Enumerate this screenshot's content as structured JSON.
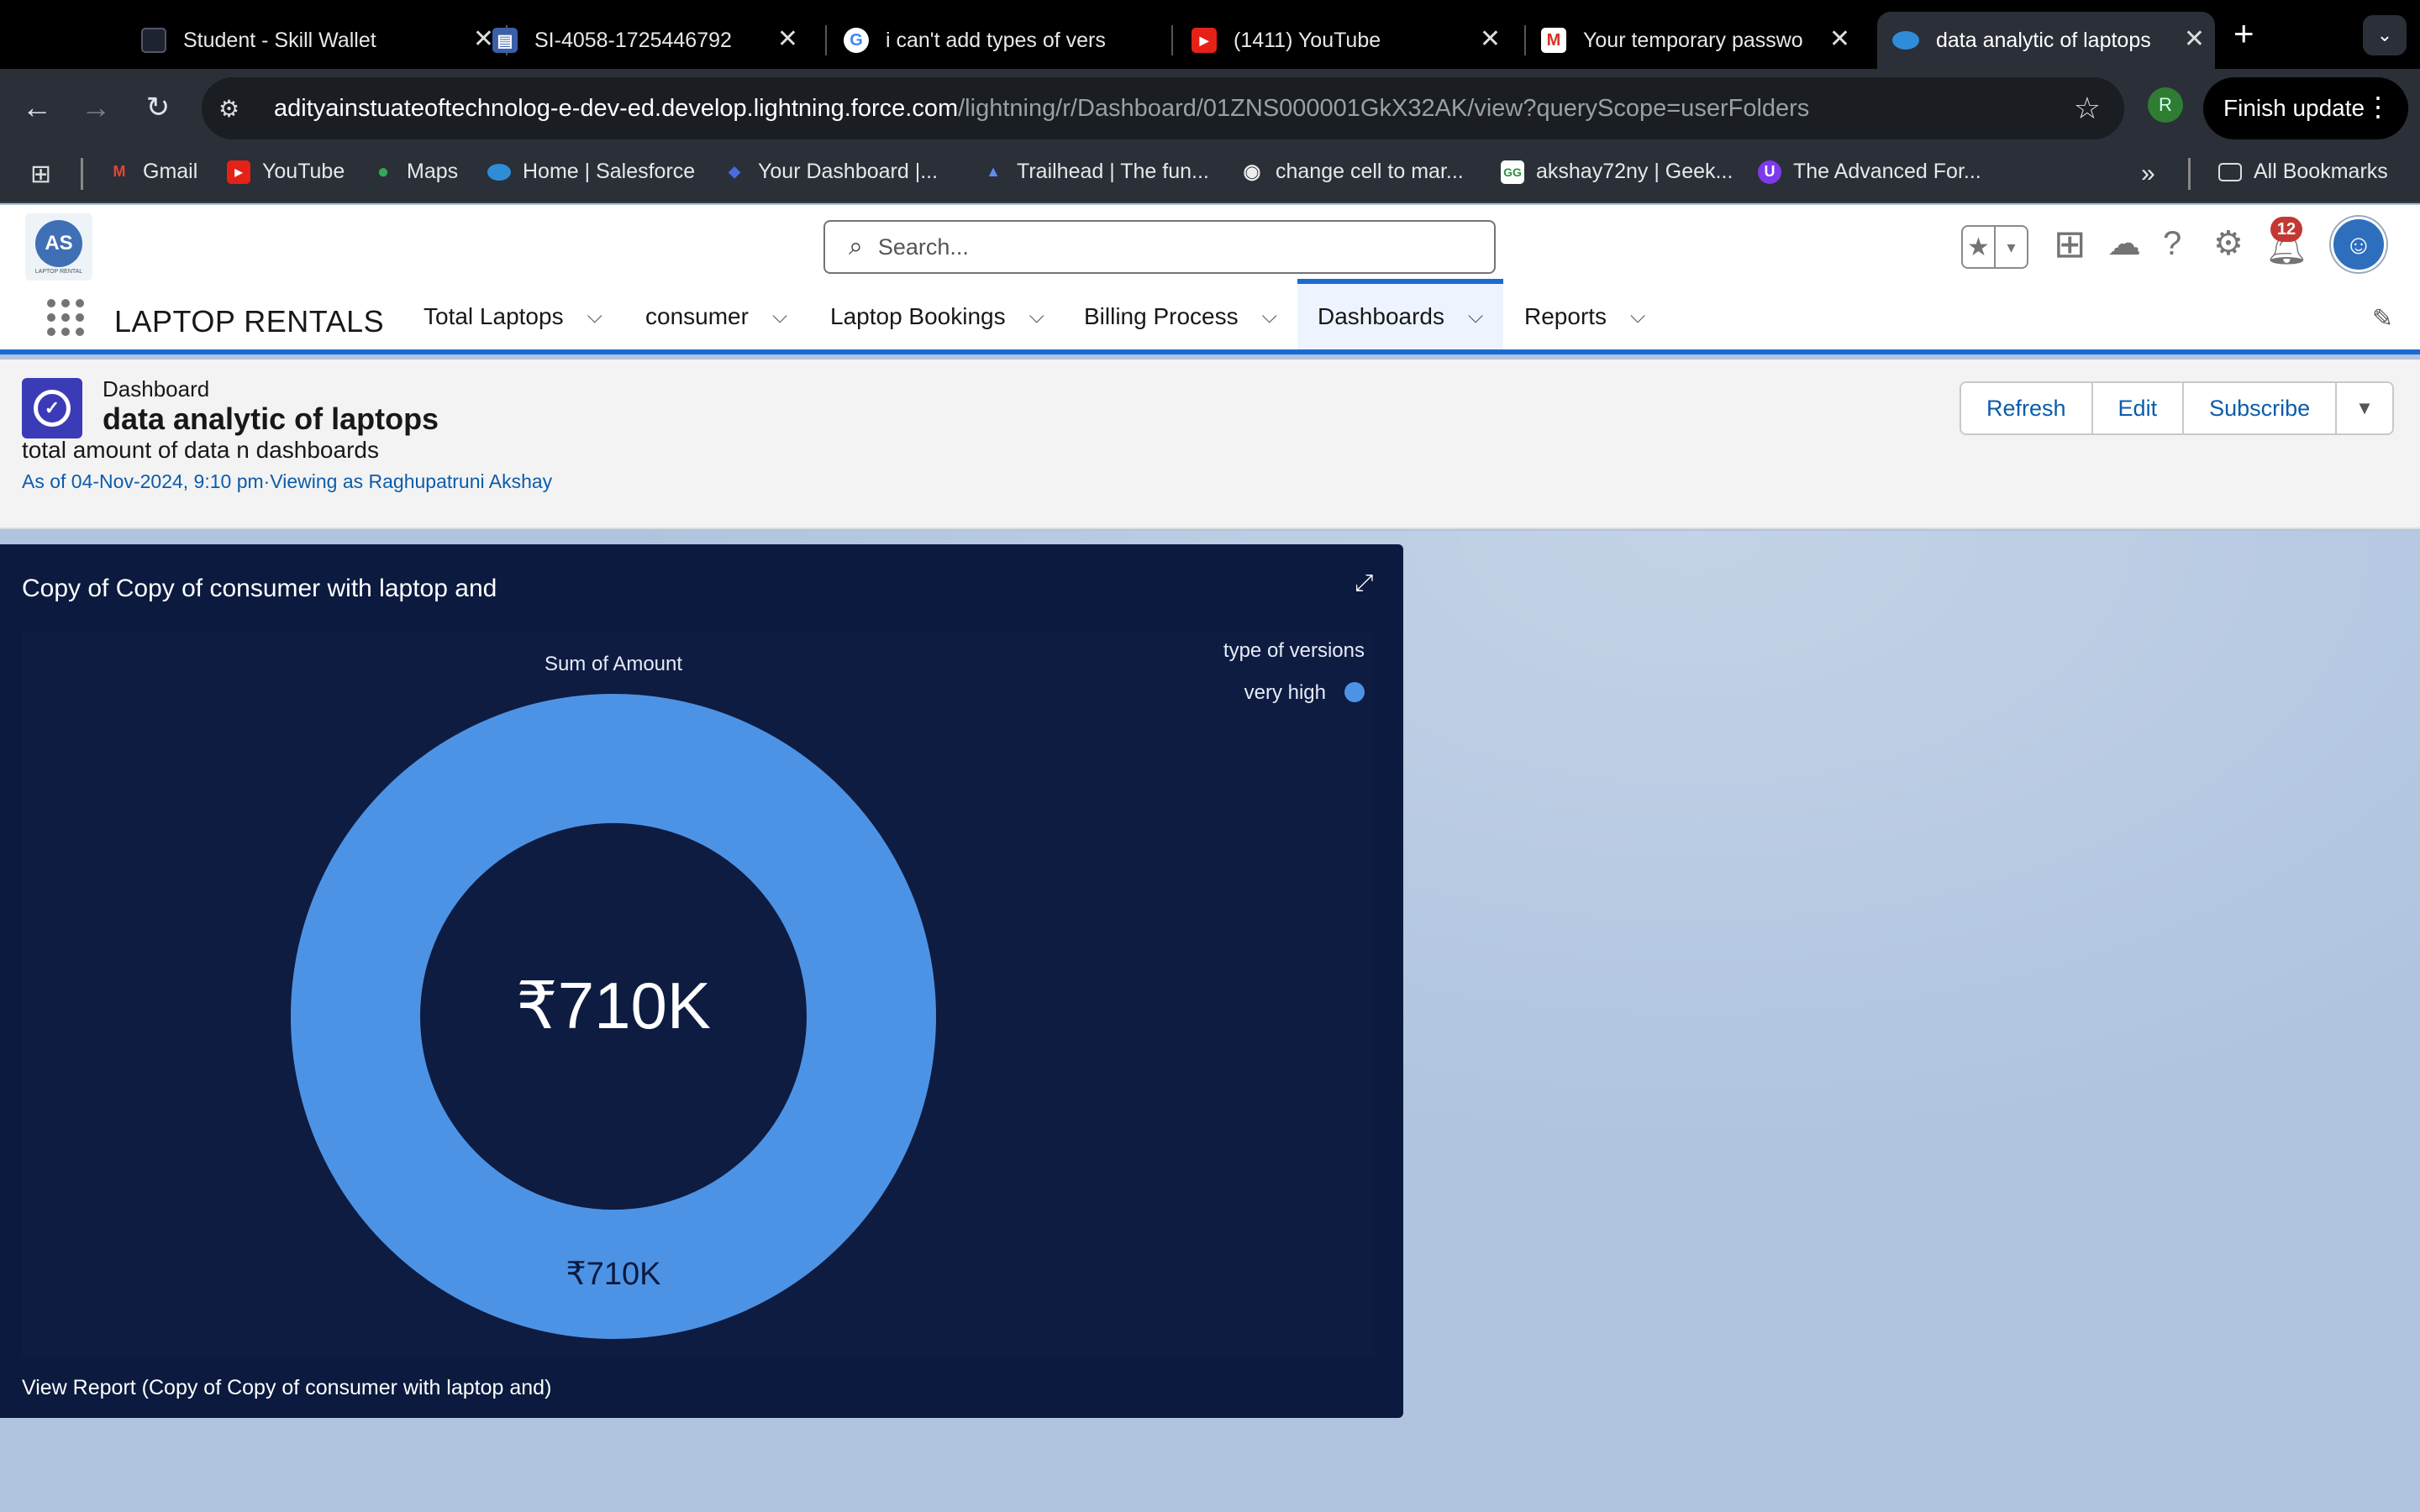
{
  "browser": {
    "tabs": [
      {
        "title": "Student - Skill Wallet",
        "favicon_color": "#2c3440"
      },
      {
        "title": "SI-4058-1725446792",
        "favicon_color": "#3b5fa8"
      },
      {
        "title": "i can't add types of vers",
        "favicon_color": "#ffffff"
      },
      {
        "title": "(1411) YouTube",
        "favicon_color": "#e62117"
      },
      {
        "title": "Your temporary passwo",
        "favicon_color": "#ffffff"
      },
      {
        "title": "data analytic of laptops",
        "favicon_color": "#2f8dd8"
      }
    ],
    "url_host": "adityainstuateoftechnolog-e-dev-ed.develop.lightning.force.com",
    "url_path": "/lightning/r/Dashboard/01ZNS000001GkX32AK/view?queryScope=userFolders",
    "profile_initial": "R",
    "finish_update_label": "Finish update",
    "bookmarks": [
      "Gmail",
      "YouTube",
      "Maps",
      "Home | Salesforce",
      "Your Dashboard |...",
      "Trailhead | The fun...",
      "change cell to mar...",
      "akshay72ny | Geek...",
      "The Advanced For..."
    ],
    "all_bookmarks_label": "All Bookmarks"
  },
  "sf": {
    "logo_text": "AS",
    "logo_subtext": "LAPTOP RENTAL",
    "search_placeholder": "Search...",
    "notification_count": "12",
    "app_name": "LAPTOP RENTALS",
    "nav_tabs": [
      "Total Laptops",
      "consumer",
      "Laptop Bookings",
      "Billing Process",
      "Dashboards",
      "Reports"
    ],
    "active_tab": "Dashboards"
  },
  "dashboard": {
    "kicker": "Dashboard",
    "title": "data analytic of laptops",
    "description": "total amount of data n dashboards",
    "as_of": "As of 04-Nov-2024, 9:10 pm·Viewing as Raghupatruni Akshay",
    "buttons": {
      "refresh": "Refresh",
      "edit": "Edit",
      "subscribe": "Subscribe"
    }
  },
  "widget": {
    "title": "Copy of Copy of consumer with laptop and",
    "view_report": "View Report (Copy of Copy of consumer with laptop and)"
  },
  "chart_data": {
    "type": "pie",
    "subtype": "donut",
    "title": "Sum of Amount",
    "legend_title": "type of versions",
    "legend_position": "top-right",
    "center_label": "₹710K",
    "slices": [
      {
        "name": "very high",
        "value": 710000,
        "label": "₹710K",
        "color": "#4d93e5"
      }
    ],
    "background_color": "#0e1c42"
  }
}
